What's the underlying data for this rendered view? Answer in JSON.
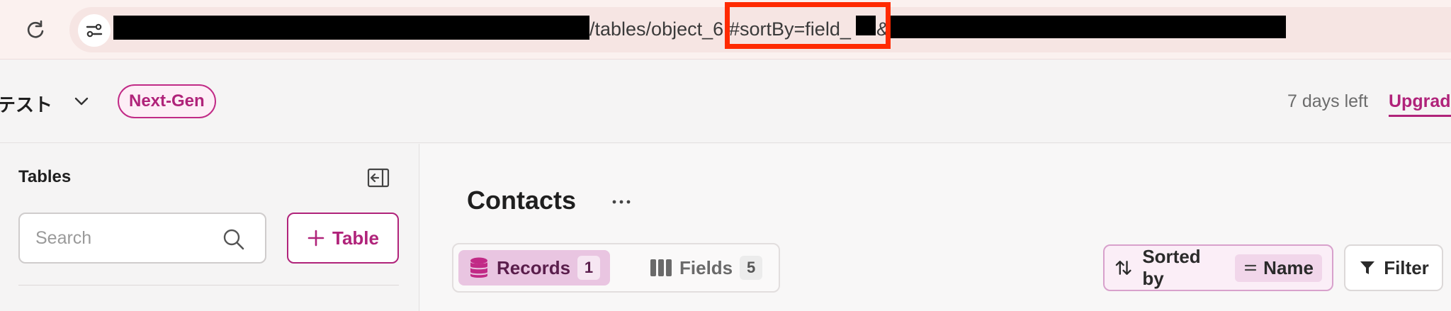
{
  "browser": {
    "url_visible_parts": {
      "path": "/tables/object_6",
      "fragment": "#sortBy=field_",
      "ampersand": "&"
    }
  },
  "header": {
    "workspace_name": "テスト",
    "badge": "Next-Gen",
    "trial": {
      "days_left": "7 days left",
      "upgrade_label": "Upgrad"
    }
  },
  "sidebar": {
    "title": "Tables",
    "search": {
      "placeholder": "Search"
    },
    "add_table_label": "Table"
  },
  "main": {
    "title": "Contacts",
    "more_label": "···",
    "tabs": [
      {
        "label": "Records",
        "count": "1",
        "active": true,
        "icon": "database-icon"
      },
      {
        "label": "Fields",
        "count": "5",
        "active": false,
        "icon": "columns-icon"
      }
    ],
    "sort": {
      "label": "Sorted by",
      "value": "Name"
    },
    "filter_label": "Filter"
  },
  "colors": {
    "accent": "#b0237a",
    "active_tab_bg": "#e9c5e1",
    "highlight_box": "#ff2a00"
  }
}
